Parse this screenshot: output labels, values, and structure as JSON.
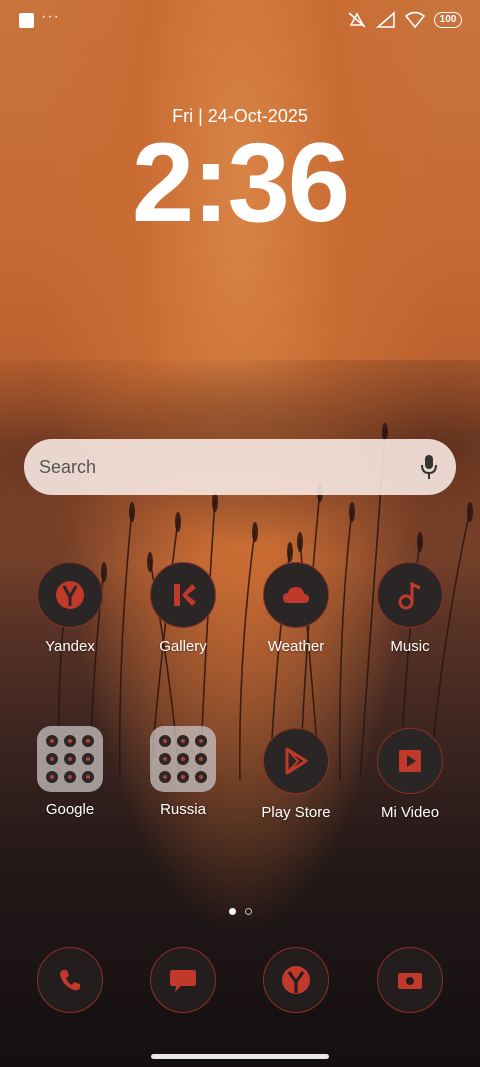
{
  "status_bar": {
    "notification_icons": [
      "square-notification-icon",
      "more-dots-icon"
    ],
    "more_dots": "···",
    "system_icons": [
      "vibrate-off-icon",
      "signal-icon",
      "wifi-icon",
      "battery-icon"
    ],
    "battery_level": "100"
  },
  "lockclock": {
    "date": "Fri | 24-Oct-2025",
    "time": "2:36"
  },
  "search": {
    "placeholder": "Search",
    "mic_icon": "mic-icon"
  },
  "apps_row1": [
    {
      "label": "Yandex",
      "icon": "yandex-icon"
    },
    {
      "label": "Gallery",
      "icon": "gallery-icon"
    },
    {
      "label": "Weather",
      "icon": "weather-icon"
    },
    {
      "label": "Music",
      "icon": "music-icon"
    }
  ],
  "apps_row2": [
    {
      "label": "Google",
      "icon": "folder-icon"
    },
    {
      "label": "Russia",
      "icon": "folder-icon"
    },
    {
      "label": "Play Store",
      "icon": "play-store-icon"
    },
    {
      "label": "Mi Video",
      "icon": "mi-video-icon"
    }
  ],
  "page_indicator": {
    "current": 1,
    "total": 2
  },
  "dock": [
    {
      "icon": "phone-icon"
    },
    {
      "icon": "messages-icon"
    },
    {
      "icon": "browser-icon"
    },
    {
      "icon": "camera-icon"
    }
  ],
  "colors": {
    "icon_accent": "#c0392b",
    "icon_bg": "#2b2626"
  }
}
